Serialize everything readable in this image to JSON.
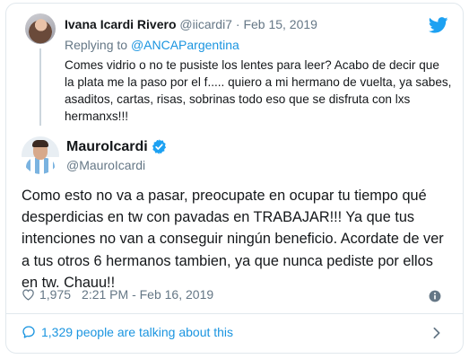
{
  "parent_tweet": {
    "name": "Ivana Icardi Rivero",
    "handle": "@iicardi7",
    "separator": "·",
    "date": "Feb 15, 2019",
    "replying_prefix": "Replying to ",
    "replying_to": "@ANCAPargentina",
    "text": "Comes vidrio o no te pusiste los lentes para leer? Acabo de decir que la plata me la paso por el f..... quiero a mi hermano de vuelta, ya sabes, asaditos, cartas, risas, sobrinas todo eso que se disfruta con lxs hermanxs!!!"
  },
  "main_tweet": {
    "name": "MauroIcardi",
    "handle": "@MauroIcardi",
    "text": "Como esto no va a pasar, preocupate en ocupar tu tiempo qué desperdicias en tw con pavadas en TRABAJAR!!! Ya que tus intenciones no van a conseguir ningún beneficio. Acordate de ver a tus otros 6 hermanos tambien, ya que nunca pediste por ellos en tw. Chauu!!",
    "likes": "1,975",
    "timestamp": "2:21 PM - Feb 16, 2019"
  },
  "footer": {
    "talking_text": "1,329 people are talking about this"
  },
  "icons": {
    "brand": "twitter-bird-icon",
    "verified": "verified-badge-icon",
    "like": "heart-icon",
    "info": "info-icon",
    "conversation": "speech-bubble-icon",
    "more": "chevron-right-icon"
  },
  "colors": {
    "accent": "#1b95e0",
    "text": "#14171a",
    "muted": "#657786",
    "border": "#e1e8ed"
  }
}
